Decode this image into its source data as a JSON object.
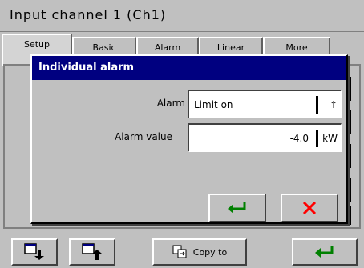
{
  "window": {
    "title": "Input channel 1 (Ch1)"
  },
  "tabs": [
    {
      "label": "Setup"
    },
    {
      "label": "Basic"
    },
    {
      "label": "Alarm"
    },
    {
      "label": "Linear"
    },
    {
      "label": "More"
    }
  ],
  "bottom_bar": {
    "prev_icon": "page-down-icon",
    "next_icon": "page-up-icon",
    "copy_label": "Copy to",
    "ok_icon": "enter-icon"
  },
  "dialog": {
    "title": "Individual alarm",
    "alarm_label": "Alarm",
    "alarm_value": "Limit on",
    "alarm_trail": "↑",
    "alarm_value_label": "Alarm value",
    "alarm_value_value": "-4.0",
    "alarm_value_unit": "kW",
    "ok_icon": "enter-icon",
    "cancel_icon": "close-icon",
    "colors": {
      "title_bg": "#000080",
      "ok": "#008000",
      "cancel": "#ff0000"
    }
  }
}
